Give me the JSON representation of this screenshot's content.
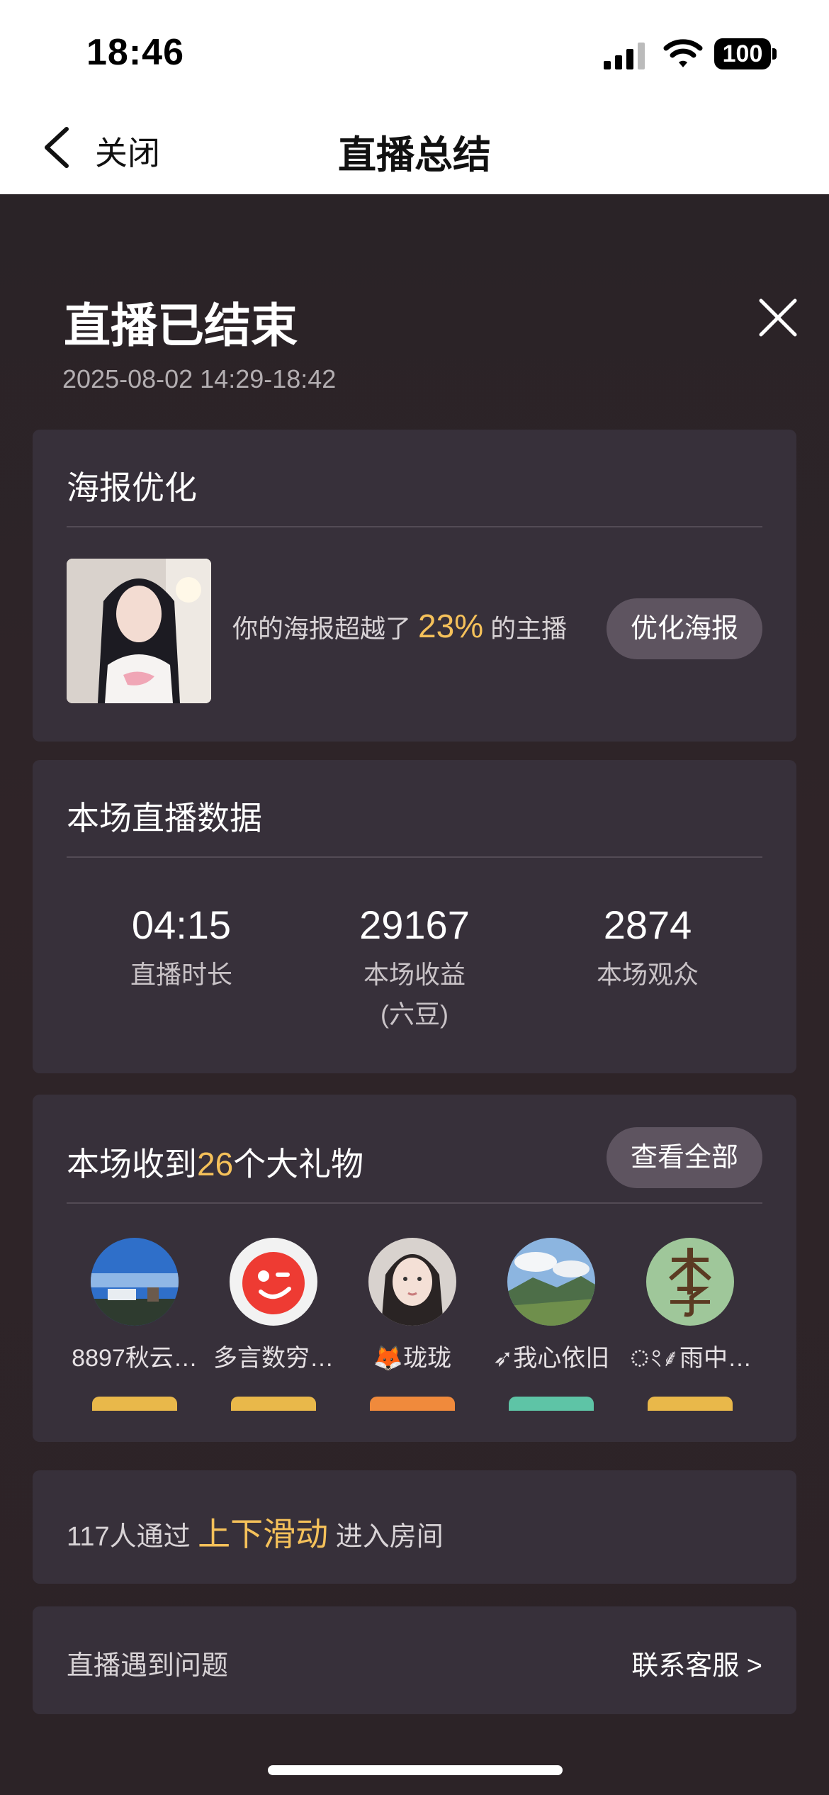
{
  "status_bar": {
    "time": "18:46",
    "battery": "100"
  },
  "nav": {
    "back_label": "关闭",
    "title": "直播总结"
  },
  "summary": {
    "title": "直播已结束",
    "time_range": "2025-08-02 14:29-18:42"
  },
  "poster": {
    "title": "海报优化",
    "text_before": "你的海报超越了",
    "percent": "23%",
    "text_after": "的主播",
    "button": "优化海报"
  },
  "stats": {
    "title": "本场直播数据",
    "items": [
      {
        "value": "04:15",
        "label": "直播时长",
        "sub": ""
      },
      {
        "value": "29167",
        "label": "本场收益",
        "sub": "(六豆)"
      },
      {
        "value": "2874",
        "label": "本场观众",
        "sub": ""
      }
    ]
  },
  "gifts": {
    "title_before": "本场收到",
    "count": "26",
    "title_after": "个大礼物",
    "button": "查看全部",
    "users": [
      {
        "name": "8897秋云…",
        "badge_color": "#e9b84a"
      },
      {
        "name": "多言数穷…",
        "badge_color": "#e9b84a"
      },
      {
        "name": "🦊珑珑",
        "badge_color": "#f08a3c"
      },
      {
        "name": "➶我心依旧",
        "badge_color": "#5ec4a6"
      },
      {
        "name": "ং⸙雨中…",
        "badge_color": "#e9b84a"
      }
    ],
    "avatar_icons": [
      "sky-landscape-avatar-icon",
      "red-wink-avatar-icon",
      "girl-portrait-avatar-icon",
      "mountain-avatar-icon",
      "li-character-avatar-icon"
    ]
  },
  "swipe": {
    "before": "117人通过",
    "highlight": "上下滑动",
    "after": "进入房间"
  },
  "support": {
    "label": "直播遇到问题",
    "link": "联系客服 >"
  },
  "colors": {
    "accent": "#f5c15a",
    "card": "#37303a",
    "button": "#5e5460"
  }
}
